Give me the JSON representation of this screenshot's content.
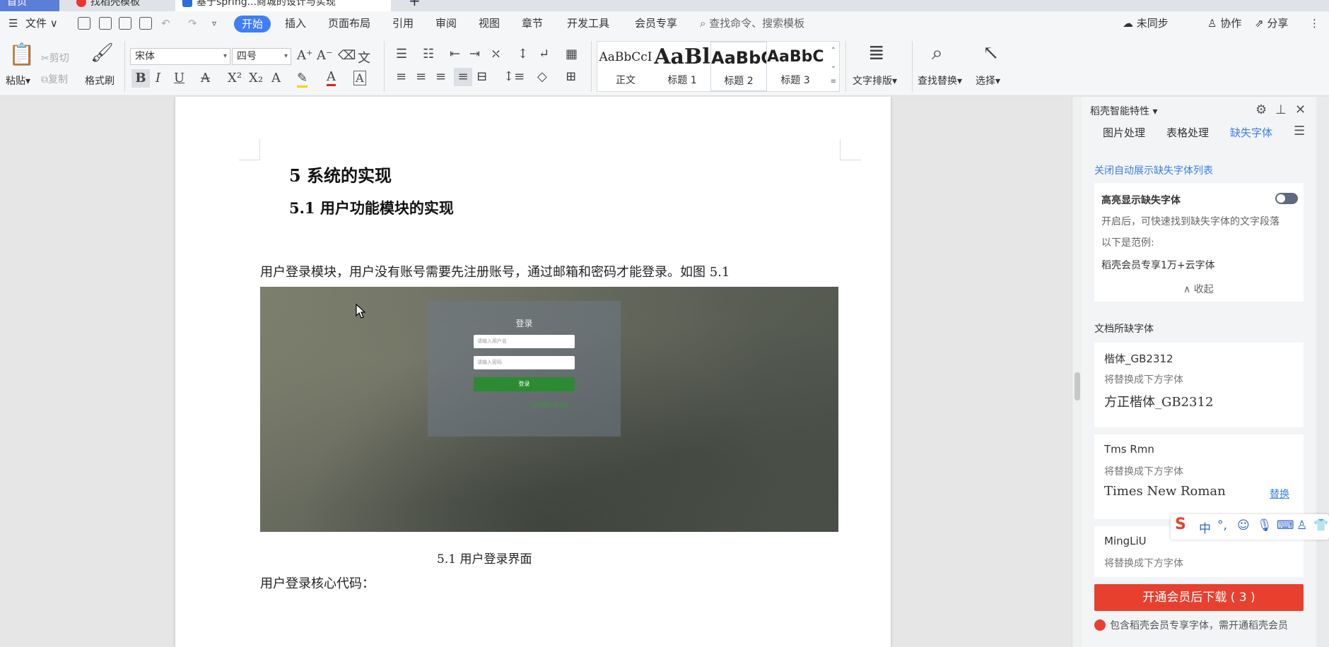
{
  "tabs": {
    "home": "首页",
    "template": "找稻壳模板",
    "doc": "基于spring...商城的设计与实现",
    "add": "+"
  },
  "menu": {
    "file": "文件",
    "items": [
      "开始",
      "插入",
      "页面布局",
      "引用",
      "审阅",
      "视图",
      "章节",
      "开发工具",
      "会员专享"
    ],
    "search": "查找命令、搜索模板",
    "sync": "未同步",
    "collab": "协作",
    "share": "分享"
  },
  "ribbon": {
    "paste": "粘贴",
    "cut": "剪切",
    "copy": "复制",
    "format_painter": "格式刷",
    "font_name": "宋体",
    "font_size": "四号",
    "styles": [
      {
        "sample": "AaBbCcI",
        "label": "正文"
      },
      {
        "sample": "AaBl",
        "label": "标题 1"
      },
      {
        "sample": "AaBbC",
        "label": "标题 2"
      },
      {
        "sample": "AaBbC",
        "label": "标题 3"
      }
    ],
    "text_layout": "文字排版",
    "find_replace": "查找替换",
    "select": "选择"
  },
  "document": {
    "heading1": "5    系统的实现",
    "heading2": "5.1  用户功能模块的实现",
    "paragraph1": "用户登录模块，用户没有账号需要先注册账号，通过邮箱和密码才能登录。如图 5.1",
    "figure": {
      "title": "登录",
      "username_placeholder": "请输入用户名",
      "password_placeholder": "请输入密码",
      "button": "登录",
      "links": "忘记密码  去注册"
    },
    "caption": "5.1  用户登录界面",
    "paragraph2": "用户登录核心代码："
  },
  "panel": {
    "title": "稻壳智能特性",
    "tabs": [
      "图片处理",
      "表格处理",
      "缺失字体"
    ],
    "link": "关闭自动展示缺失字体列表",
    "highlight_title": "高亮显示缺失字体",
    "highlight_desc": "开启后，可快速找到缺失字体的文字段落",
    "example_label": "以下是范例:",
    "example_text": "稻壳会员专享1万+云字体",
    "collapse": "收起",
    "section": "文档所缺字体",
    "fonts": [
      {
        "name": "楷体_GB2312",
        "hint": "将替换成下方字体",
        "replacement": "方正楷体_GB2312",
        "action": ""
      },
      {
        "name": "Tms Rmn",
        "hint": "将替换成下方字体",
        "replacement": "Times New Roman",
        "action": "替换"
      },
      {
        "name": "MingLiU",
        "hint": "将替换成下方字体",
        "replacement": "",
        "action": ""
      }
    ],
    "download_button": "开通会员后下载 ( 3 )",
    "download_note": "包含稻壳会员专享字体，需开通稻壳会员"
  },
  "ime": {
    "mode": "中"
  }
}
